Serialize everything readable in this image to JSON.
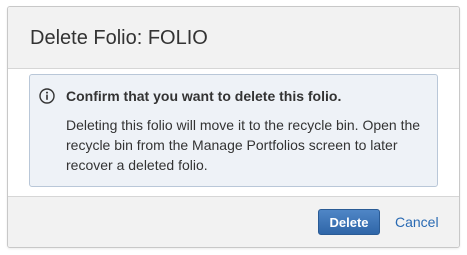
{
  "dialog": {
    "title": "Delete Folio: FOLIO",
    "info": {
      "icon": "info-circle-icon",
      "heading": "Confirm that you want to delete this folio.",
      "text_lines": [
        "Deleting this folio will move it to the recycle bin. Open the",
        "recycle bin from the Manage Portfolios screen to later",
        "recover a deleted folio."
      ]
    },
    "buttons": {
      "delete_label": "Delete",
      "cancel_label": "Cancel"
    }
  },
  "colors": {
    "primary_button": "#3a74b8",
    "link": "#2a6ab3",
    "info_background": "#eef2f7",
    "info_border": "#b9c7d8"
  }
}
